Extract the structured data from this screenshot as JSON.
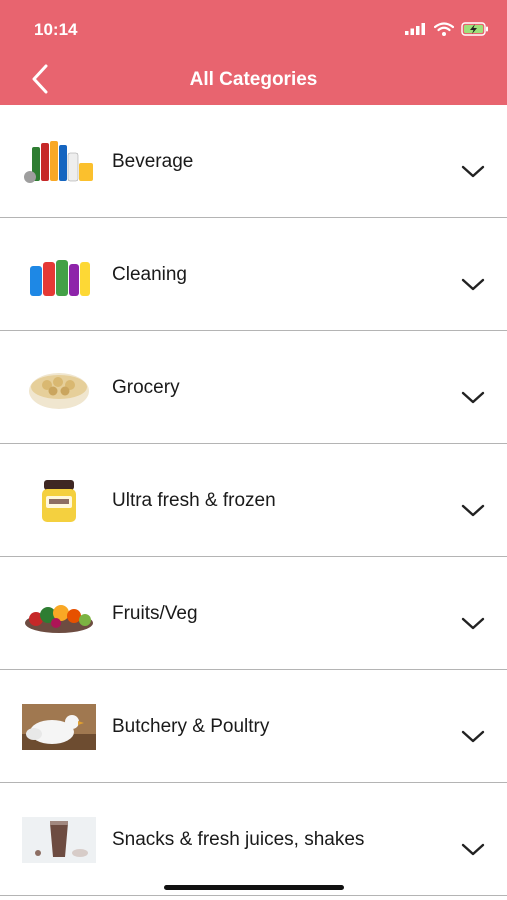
{
  "status_bar": {
    "time": "10:14"
  },
  "header": {
    "title": "All Categories",
    "back_icon": "chevron-left-icon"
  },
  "categories": [
    {
      "label": "Beverage",
      "thumbnail": "beverage-bottles-image"
    },
    {
      "label": "Cleaning",
      "thumbnail": "cleaning-bottles-image"
    },
    {
      "label": "Grocery",
      "thumbnail": "cashew-bowl-image"
    },
    {
      "label": "Ultra fresh & frozen",
      "thumbnail": "jar-image"
    },
    {
      "label": "Fruits/Veg",
      "thumbnail": "fruits-vegetables-image"
    },
    {
      "label": "Butchery & Poultry",
      "thumbnail": "poultry-image"
    },
    {
      "label": "Snacks & fresh juices, shakes",
      "thumbnail": "shake-image"
    }
  ],
  "colors": {
    "header_bg": "#e8646f",
    "divider": "#b4b4b4",
    "text": "#1a1a1a"
  }
}
